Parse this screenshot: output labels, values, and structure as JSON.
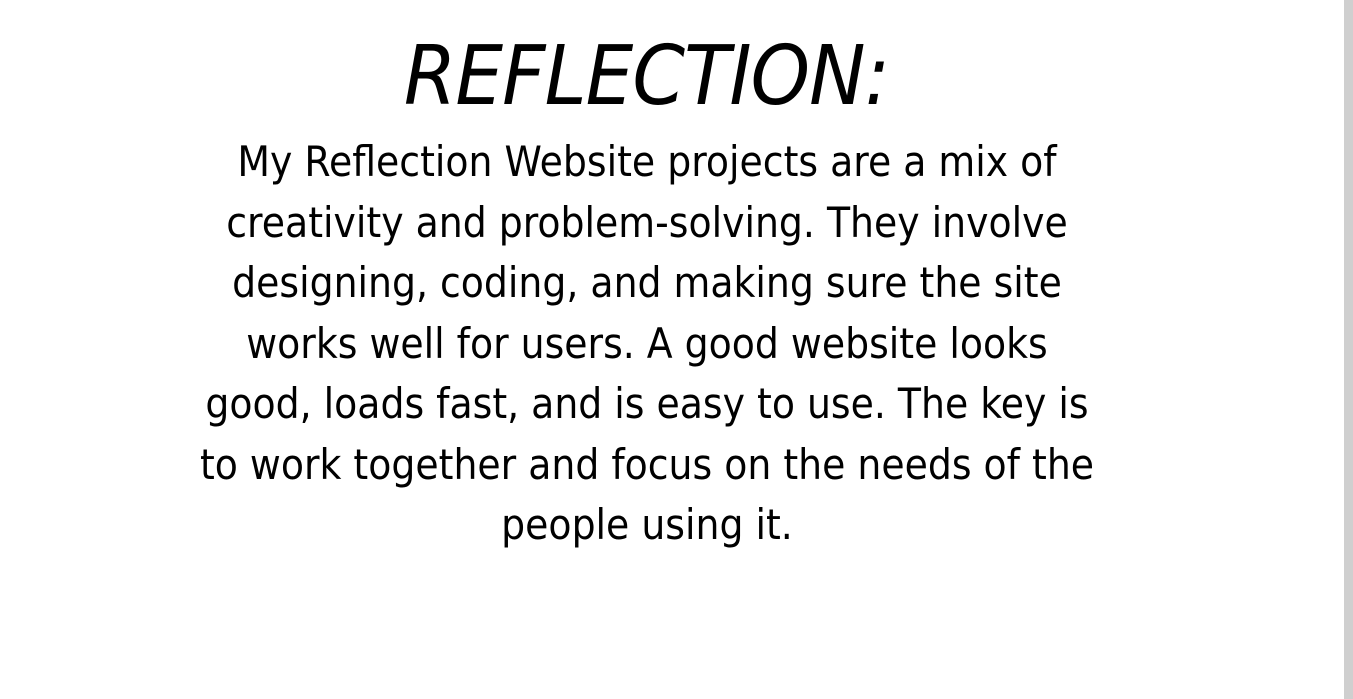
{
  "slide": {
    "title": "REFLECTION:",
    "body": "My Reflection Website projects are a mix of creativity and problem-solving. They involve designing, coding, and making sure the site works well for users. A good website looks good, loads fast, and is easy to use. The key is to work together and focus on the needs of the people using it."
  }
}
